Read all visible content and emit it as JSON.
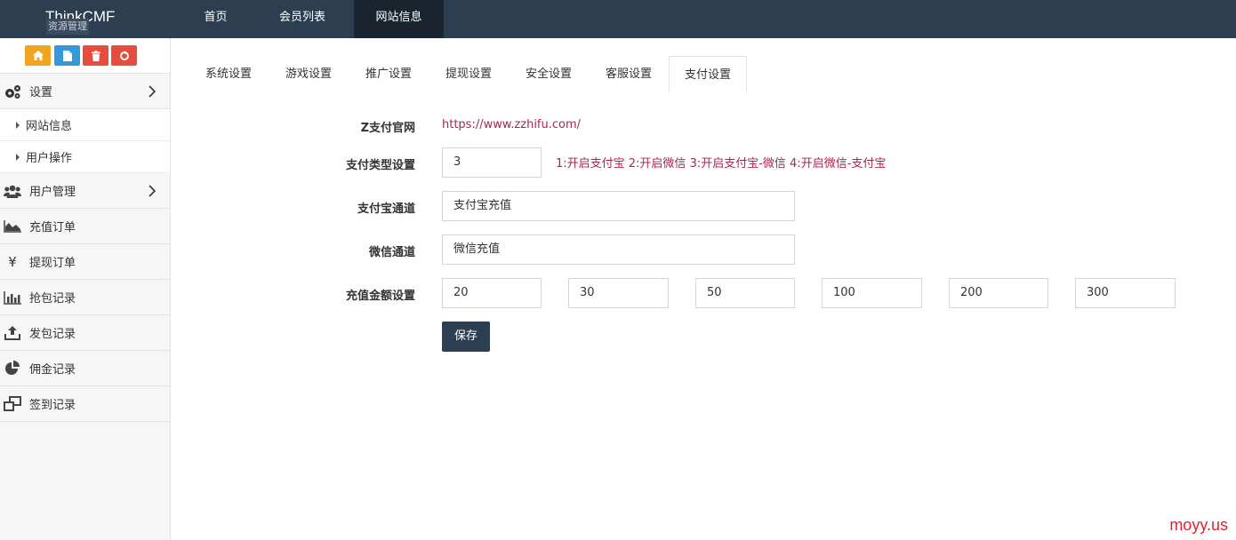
{
  "app": {
    "brand": "ThinkCMF"
  },
  "topnav": {
    "items": [
      {
        "label": "首页"
      },
      {
        "label": "会员列表"
      },
      {
        "label": "网站信息"
      }
    ]
  },
  "shortcuts": {
    "tooltip": "资源管理",
    "buttons": [
      {
        "icon": "home-icon",
        "color": "#f0a420"
      },
      {
        "icon": "file-icon",
        "color": "#3498db"
      },
      {
        "icon": "trash-icon",
        "color": "#e74c3c"
      },
      {
        "icon": "recycle-icon",
        "color": "#e74c3c"
      }
    ]
  },
  "sidebar": {
    "settings": {
      "label": "设置",
      "icon": "gears-icon"
    },
    "settings_children": [
      {
        "label": "网站信息"
      },
      {
        "label": "用户操作"
      }
    ],
    "items": [
      {
        "label": "用户管理",
        "icon": "users-icon"
      },
      {
        "label": "充值订单",
        "icon": "area-chart-icon"
      },
      {
        "label": "提现订单",
        "icon": "yen-icon"
      },
      {
        "label": "抢包记录",
        "icon": "bar-chart-icon"
      },
      {
        "label": "发包记录",
        "icon": "upload-icon"
      },
      {
        "label": "佣金记录",
        "icon": "pie-chart-icon"
      },
      {
        "label": "签到记录",
        "icon": "windows-icon"
      }
    ]
  },
  "tabs": [
    {
      "label": "系统设置"
    },
    {
      "label": "游戏设置"
    },
    {
      "label": "推广设置"
    },
    {
      "label": "提现设置"
    },
    {
      "label": "安全设置"
    },
    {
      "label": "客服设置"
    },
    {
      "label": "支付设置"
    }
  ],
  "form": {
    "official_site": {
      "label": "Z支付官网",
      "value": "https://www.zzhifu.com/"
    },
    "pay_type": {
      "label": "支付类型设置",
      "value": "3",
      "hint": "1:开启支付宝 2:开启微信 3:开启支付宝-微信 4:开启微信-支付宝"
    },
    "alipay_channel": {
      "label": "支付宝通道",
      "value": "支付宝充值"
    },
    "wechat_channel": {
      "label": "微信通道",
      "value": "微信充值"
    },
    "recharge_amounts": {
      "label": "充值金额设置",
      "values": [
        "20",
        "30",
        "50",
        "100",
        "200",
        "300"
      ]
    },
    "save_label": "保存"
  },
  "watermark": "moyy.us",
  "colors": {
    "topbar": "#2c3e50",
    "active_nav": "#1a242f",
    "accent_text": "#a52a4c",
    "watermark": "#e0242c"
  }
}
